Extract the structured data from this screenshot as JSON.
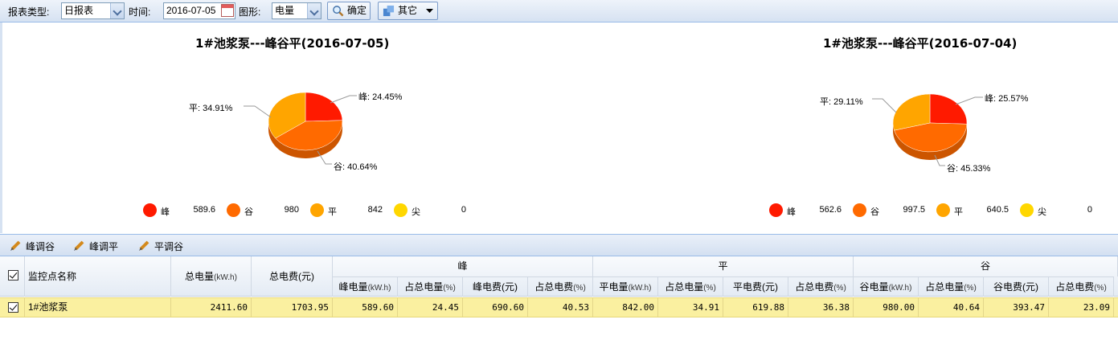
{
  "toolbar": {
    "report_type_label": "报表类型:",
    "report_type_value": "日报表",
    "time_label": "时间:",
    "date_value": "2016-07-05",
    "graph_label": "图形:",
    "graph_value": "电量",
    "confirm_label": "确定",
    "other_label": "其它"
  },
  "chart_data": [
    {
      "type": "pie",
      "title": "1#池浆泵---峰谷平(2016-07-05)",
      "slices": [
        {
          "name": "峰",
          "percent": 24.45,
          "label": "峰: 24.45%",
          "color": "#ff1a00"
        },
        {
          "name": "谷",
          "percent": 40.64,
          "label": "谷: 40.64%",
          "color": "#ff6a00"
        },
        {
          "name": "平",
          "percent": 34.91,
          "label": "平: 34.91%",
          "color": "#ffa500"
        }
      ],
      "legend": [
        {
          "name": "峰",
          "value": "589.6",
          "color": "#ff1a00"
        },
        {
          "name": "谷",
          "value": "980",
          "color": "#ff6a00"
        },
        {
          "name": "平",
          "value": "842",
          "color": "#ffa500"
        },
        {
          "name": "尖",
          "value": "0",
          "color": "#ffd700"
        }
      ]
    },
    {
      "type": "pie",
      "title": "1#池浆泵---峰谷平(2016-07-04)",
      "slices": [
        {
          "name": "峰",
          "percent": 25.57,
          "label": "峰: 25.57%",
          "color": "#ff1a00"
        },
        {
          "name": "谷",
          "percent": 45.33,
          "label": "谷: 45.33%",
          "color": "#ff6a00"
        },
        {
          "name": "平",
          "percent": 29.11,
          "label": "平: 29.11%",
          "color": "#ffa500"
        }
      ],
      "legend": [
        {
          "name": "峰",
          "value": "562.6",
          "color": "#ff1a00"
        },
        {
          "name": "谷",
          "value": "997.5",
          "color": "#ff6a00"
        },
        {
          "name": "平",
          "value": "640.5",
          "color": "#ffa500"
        },
        {
          "name": "尖",
          "value": "0",
          "color": "#ffd700"
        }
      ]
    }
  ],
  "grid_toolbar": {
    "peak_to_valley": "峰调谷",
    "peak_to_flat": "峰调平",
    "flat_to_valley": "平调谷"
  },
  "table": {
    "headers": {
      "name": "监控点名称",
      "total_kwh": "总电量",
      "total_kwh_unit": "(kW.h)",
      "total_cost": "总电费(元)",
      "group_peak": "峰",
      "group_flat": "平",
      "group_valley": "谷",
      "peak_kwh": "峰电量",
      "peak_kwh_pct": "占总电量",
      "peak_cost": "峰电费(元)",
      "peak_cost_pct": "占总电费",
      "flat_kwh": "平电量",
      "flat_kwh_pct": "占总电量",
      "flat_cost": "平电费(元)",
      "flat_cost_pct": "占总电费",
      "valley_kwh": "谷电量",
      "valley_kwh_pct": "占总电量",
      "valley_cost": "谷电费(元)",
      "valley_cost_pct": "占总电费",
      "unit_kwh": "(kW.h)",
      "unit_pct": "(%)"
    },
    "rows": [
      {
        "name": "1#池浆泵",
        "cells": [
          "2411.60",
          "1703.95",
          "589.60",
          "24.45",
          "690.60",
          "40.53",
          "842.00",
          "34.91",
          "619.88",
          "36.38",
          "980.00",
          "40.64",
          "393.47",
          "23.09"
        ]
      }
    ]
  }
}
